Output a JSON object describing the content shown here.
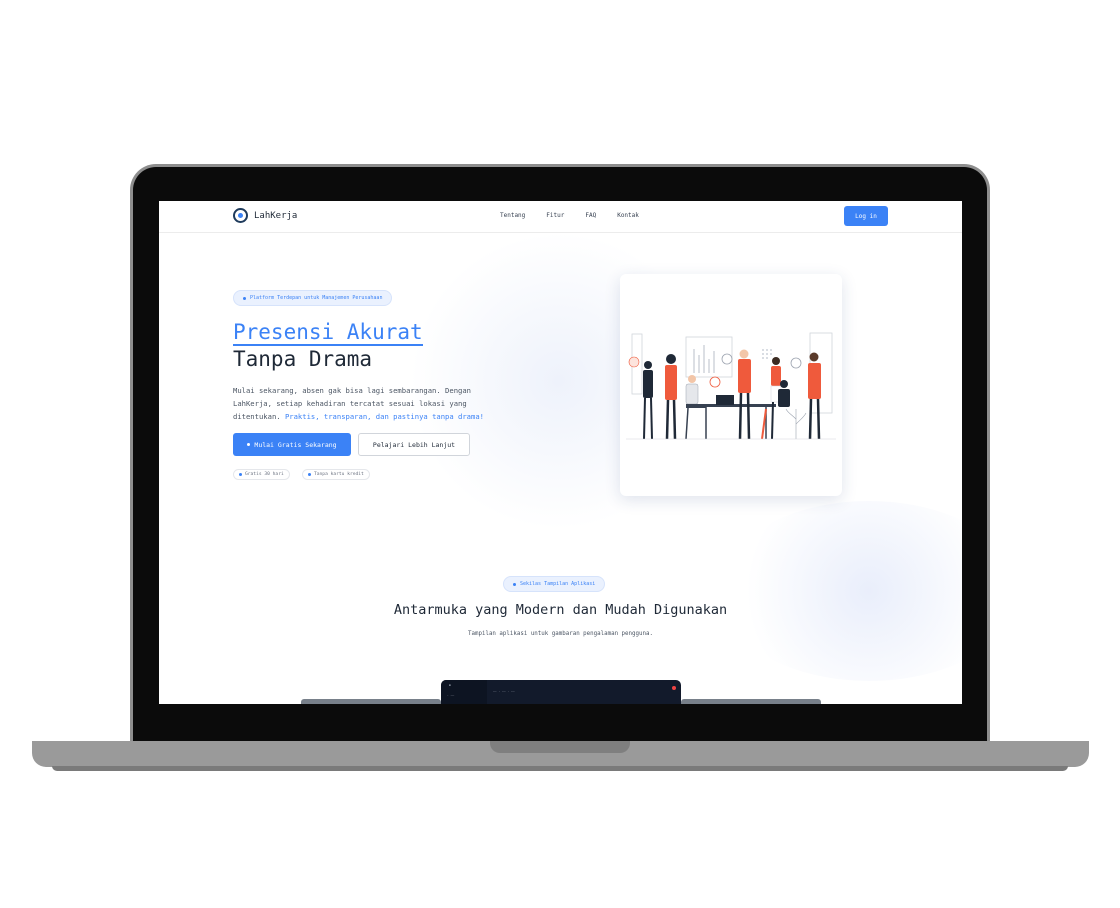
{
  "nav": {
    "brand": "LahKerja",
    "links": [
      "Tentang",
      "Fitur",
      "FAQ",
      "Kontak"
    ],
    "login_label": "Log in"
  },
  "hero": {
    "badge": "Platform Terdepan untuk Manajemen Perusahaan",
    "title_line1": "Presensi Akurat",
    "title_line2": "Tanpa Drama",
    "desc_line1": "Mulai sekarang, absen gak bisa lagi sembarangan. Dengan",
    "desc_line2": "LahKerja, setiap kehadiran tercatat sesuai lokasi yang",
    "desc_line3_plain": "ditentukan.",
    "desc_line3_highlight": "Praktis, transparan, dan pastinya tanpa drama!",
    "primary_cta": "Mulai Gratis Sekarang",
    "secondary_cta": "Pelajari Lebih Lanjut",
    "chips": [
      "Gratis 30 hari",
      "Tanpa kartu kredit"
    ]
  },
  "preview_section": {
    "badge": "Sekilas Tampilan Aplikasi",
    "title": "Antarmuka yang Modern dan Mudah Digunakan",
    "subtitle": "Tampilan aplikasi untuk gambaran pengalaman pengguna."
  },
  "colors": {
    "accent": "#3b82f6",
    "text_dark": "#1f2937",
    "illustration_accent": "#ef5a3c"
  }
}
